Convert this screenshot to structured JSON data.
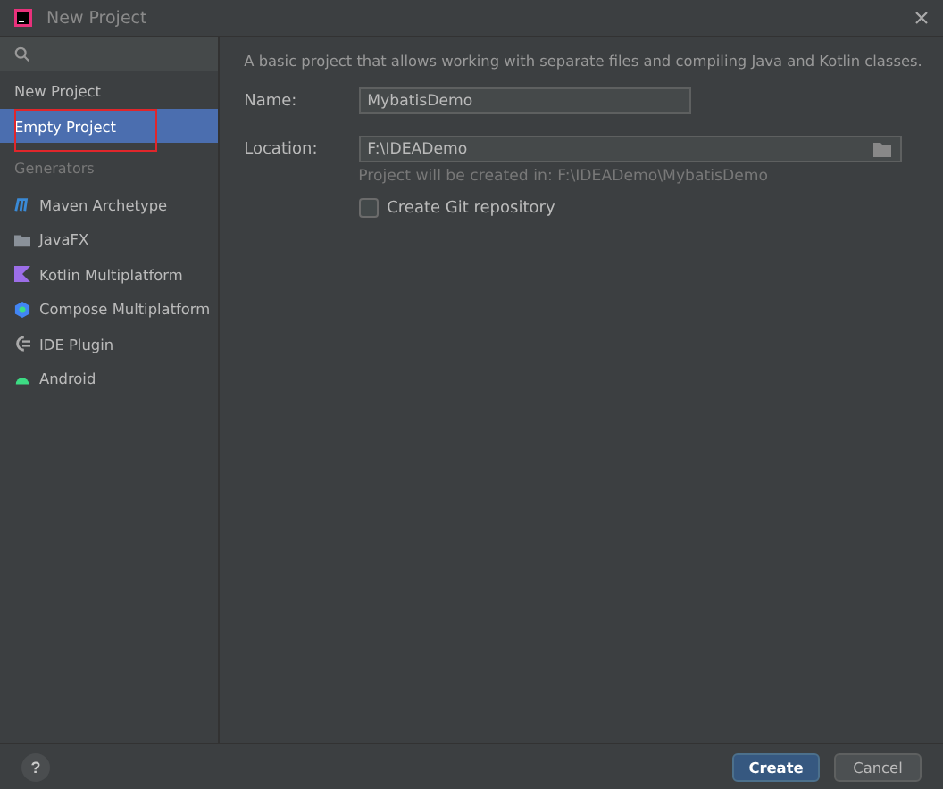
{
  "window": {
    "title": "New Project"
  },
  "sidebar": {
    "items": [
      {
        "label": "New Project",
        "selected": false,
        "highlighted": false
      },
      {
        "label": "Empty Project",
        "selected": true,
        "highlighted": true
      }
    ],
    "section_title": "Generators",
    "generators": [
      {
        "label": "Maven Archetype",
        "kind": "maven",
        "selected": false
      },
      {
        "label": "JavaFX",
        "kind": "folder",
        "selected": false
      },
      {
        "label": "Kotlin Multiplatform",
        "kind": "kotlin",
        "selected": false
      },
      {
        "label": "Compose Multiplatform",
        "kind": "compose",
        "selected": false
      },
      {
        "label": "IDE Plugin",
        "kind": "plugin",
        "selected": false
      },
      {
        "label": "Android",
        "kind": "android",
        "selected": false
      }
    ]
  },
  "form": {
    "description": "A basic project that allows working with separate files and compiling Java and Kotlin classes.",
    "name_label": "Name:",
    "name_value": "MybatisDemo",
    "location_label": "Location:",
    "location_value": "F:\\IDEADemo",
    "location_hint": "Project will be created in: F:\\IDEADemo\\MybatisDemo",
    "git_label": "Create Git repository",
    "git_checked": false
  },
  "footer": {
    "help": "?",
    "buttons": [
      {
        "label": "Create",
        "primary": true
      },
      {
        "label": "Cancel",
        "primary": false
      }
    ]
  }
}
